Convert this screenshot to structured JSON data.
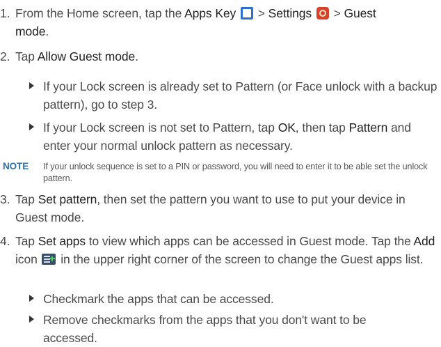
{
  "steps": [
    {
      "number": "1.",
      "pre": "From the Home screen, tap the ",
      "apps_key": "Apps Key",
      "sep1": " > ",
      "settings": "Settings",
      "sep2": " > ",
      "guest_mode": "Guest mode",
      "end": "."
    },
    {
      "number": "2.",
      "pre": "Tap ",
      "allow": "Allow Guest mode",
      "end": ".",
      "bullets": [
        {
          "text": "If your Lock screen is already set to Pattern (or Face unlock with a backup pattern), go to step 3."
        },
        {
          "t1": "If your Lock screen is not set to Pattern, tap ",
          "ok": "OK",
          "t2": ", then tap ",
          "pattern": "Pattern",
          "t3": " and enter your normal unlock pattern as necessary."
        }
      ]
    },
    {
      "number": "3.",
      "pre": "Tap ",
      "set_pattern": "Set pattern",
      "rest": ", then set the pattern you want to use to put your device in Guest mode."
    },
    {
      "number": "4.",
      "pre": "Tap ",
      "set_apps": "Set apps",
      "mid": " to view which apps can be accessed in Guest mode. Tap the ",
      "add": "Add",
      "icon_word": " icon ",
      "rest": " in the upper right corner of the screen to change the Guest apps list.",
      "bullets": [
        "Checkmark the apps that can be accessed.",
        "Remove checkmarks from the apps that you don't want to be accessed."
      ]
    }
  ],
  "note": {
    "label": "NOTE",
    "text": "If your unlock sequence is set to a PIN or password, you will need to enter it to be able set the unlock pattern."
  },
  "icons": {
    "apps_key": "apps-grid-icon",
    "settings": "settings-gear-icon",
    "add": "add-list-icon"
  }
}
